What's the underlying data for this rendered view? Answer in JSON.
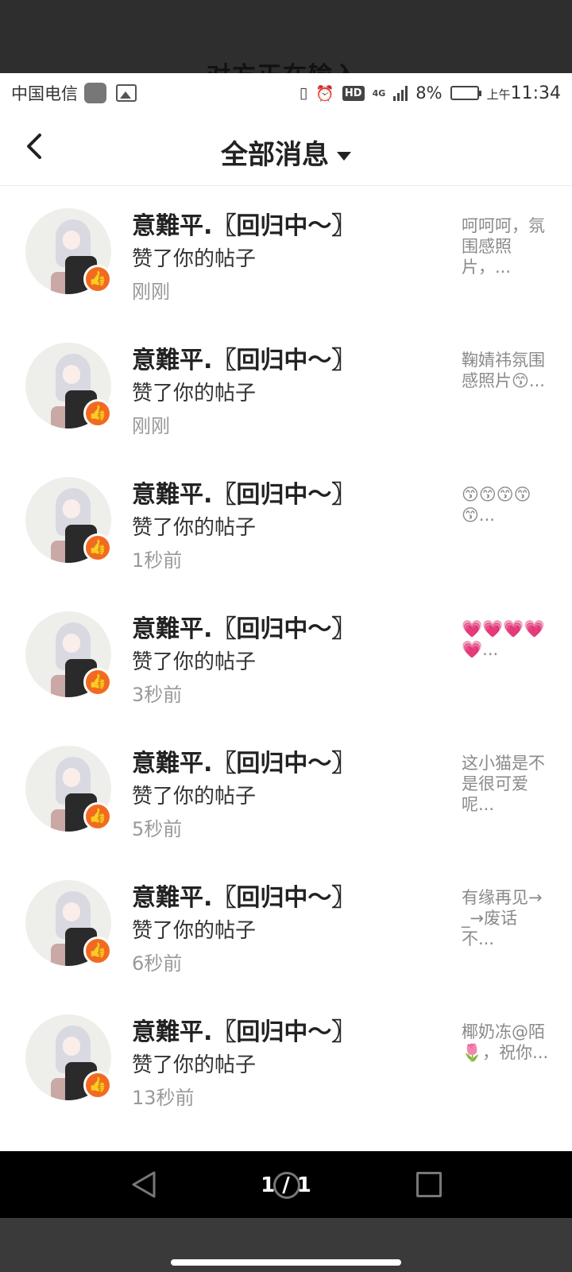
{
  "overlay": {
    "faint_text": "对方正在输入"
  },
  "status": {
    "carrier": "中国电信",
    "network": "4G",
    "hd": "HD",
    "battery": "8%",
    "am": "上午",
    "time": "11:34"
  },
  "header": {
    "title": "全部消息"
  },
  "messages": [
    {
      "name": "意難平.〖回归中～〗",
      "action": "赞了你的帖子",
      "time": "刚刚",
      "preview": "呵呵呵，氛围感照片，..."
    },
    {
      "name": "意難平.〖回归中～〗",
      "action": "赞了你的帖子",
      "time": "刚刚",
      "preview": "鞠婧祎氛围感照片😙..."
    },
    {
      "name": "意難平.〖回归中～〗",
      "action": "赞了你的帖子",
      "time": "1秒前",
      "preview": "😙😙😙😙😙..."
    },
    {
      "name": "意難平.〖回归中～〗",
      "action": "赞了你的帖子",
      "time": "3秒前",
      "preview": "💗💗💗💗💗..."
    },
    {
      "name": "意難平.〖回归中～〗",
      "action": "赞了你的帖子",
      "time": "5秒前",
      "preview": "这小猫是不是很可爱呢..."
    },
    {
      "name": "意難平.〖回归中～〗",
      "action": "赞了你的帖子",
      "time": "6秒前",
      "preview": "有缘再见→_→废话不..."
    },
    {
      "name": "意難平.〖回归中～〗",
      "action": "赞了你的帖子",
      "time": "13秒前",
      "preview": "椰奶冻@陌🌷，祝你..."
    }
  ],
  "viewer": {
    "pager": "1 / 1"
  },
  "colors": {
    "like_badge": "#f26a21",
    "muted_text": "#999999"
  },
  "icons": {
    "back": "chevron-left-icon",
    "dropdown": "caret-down-icon",
    "like": "thumbs-up-icon"
  }
}
